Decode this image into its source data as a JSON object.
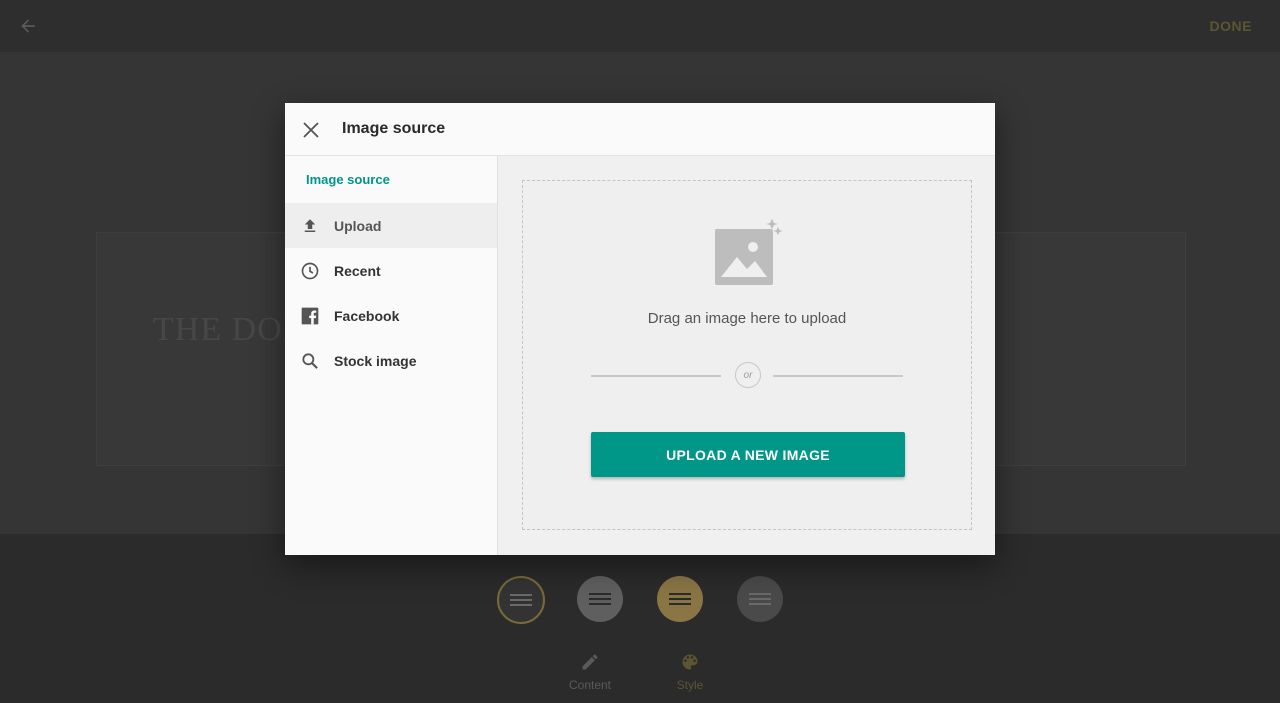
{
  "editor": {
    "done_label": "DONE",
    "background_heading": "THE DOLL",
    "style_options": [
      {
        "color": "#3a3a3a",
        "ring": "#7a6a3a"
      },
      {
        "color": "#5f5f5f"
      },
      {
        "color": "#8a7645"
      },
      {
        "color": "#4a4a4a"
      }
    ],
    "bottom_tabs": {
      "content_label": "Content",
      "style_label": "Style"
    }
  },
  "modal": {
    "title": "Image source",
    "sidebar": {
      "heading": "Image source",
      "items": [
        {
          "label": "Upload",
          "icon": "upload-icon",
          "active": true
        },
        {
          "label": "Recent",
          "icon": "clock-icon",
          "active": false
        },
        {
          "label": "Facebook",
          "icon": "facebook-icon",
          "active": false
        },
        {
          "label": "Stock image",
          "icon": "search-icon",
          "active": false
        }
      ]
    },
    "dropzone": {
      "icon": "image-sparkle-icon",
      "drag_text": "Drag an image here to upload",
      "or_text": "or",
      "upload_button": "UPLOAD A NEW IMAGE"
    }
  },
  "colors": {
    "accent": "#009688",
    "overlay": "#3a3a3a"
  }
}
